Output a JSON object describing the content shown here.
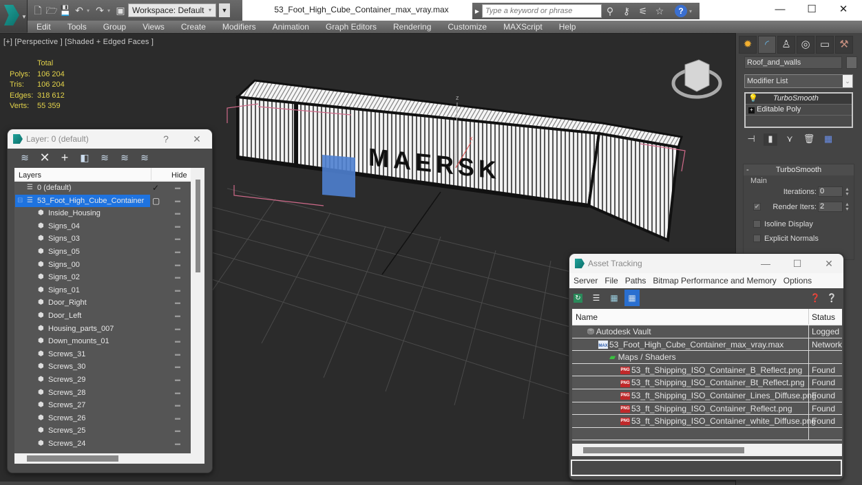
{
  "app": {
    "workspace_label": "Workspace: Default",
    "document_title": "53_Foot_High_Cube_Container_max_vray.max",
    "search_placeholder": "Type a keyword or phrase",
    "window_controls": {
      "minimize": "—",
      "maximize": "☐",
      "close": "✕"
    }
  },
  "menu": [
    "Edit",
    "Tools",
    "Group",
    "Views",
    "Create",
    "Modifiers",
    "Animation",
    "Graph Editors",
    "Rendering",
    "Customize",
    "MAXScript",
    "Help"
  ],
  "viewport": {
    "label": "[+] [Perspective ] [Shaded + Edged Faces ]",
    "stats": {
      "header": "Total",
      "rows": [
        {
          "label": "Polys:",
          "value": "106 204"
        },
        {
          "label": "Tris:",
          "value": "106 204"
        },
        {
          "label": "Edges:",
          "value": "318 612"
        },
        {
          "label": "Verts:",
          "value": "55 359"
        }
      ]
    },
    "axis_labels": {
      "z": "z",
      "x": "x"
    },
    "container_text": "MAERSK"
  },
  "command_panel": {
    "object_name": "Roof_and_walls",
    "modifier_list_label": "Modifier List",
    "stack": [
      {
        "label": "TurboSmooth",
        "selected": true
      },
      {
        "label": "Editable Poly",
        "selected": false
      }
    ],
    "rollout": {
      "title": "TurboSmooth",
      "group": "Main",
      "iterations_label": "Iterations:",
      "iterations_value": "0",
      "render_iters_label": "Render Iters:",
      "render_iters_value": "2",
      "render_iters_checked": true,
      "isoline_label": "Isoline Display",
      "explicit_normals_label": "Explicit Normals"
    }
  },
  "layer_window": {
    "title": "Layer: 0 (default)",
    "help": "?",
    "close": "✕",
    "col_layers": "Layers",
    "col_hide": "Hide",
    "layers": [
      {
        "name": "0 (default)",
        "level": 0,
        "type": "layer",
        "current": true
      },
      {
        "name": "53_Foot_High_Cube_Container",
        "level": 0,
        "type": "layer",
        "selected": true
      },
      {
        "name": "Inside_Housing",
        "level": 1,
        "type": "object"
      },
      {
        "name": "Signs_04",
        "level": 1,
        "type": "object"
      },
      {
        "name": "Signs_03",
        "level": 1,
        "type": "object"
      },
      {
        "name": "Signs_05",
        "level": 1,
        "type": "object"
      },
      {
        "name": "Signs_00",
        "level": 1,
        "type": "object"
      },
      {
        "name": "Signs_02",
        "level": 1,
        "type": "object"
      },
      {
        "name": "Signs_01",
        "level": 1,
        "type": "object"
      },
      {
        "name": "Door_Right",
        "level": 1,
        "type": "object"
      },
      {
        "name": "Door_Left",
        "level": 1,
        "type": "object"
      },
      {
        "name": "Housing_parts_007",
        "level": 1,
        "type": "object"
      },
      {
        "name": "Down_mounts_01",
        "level": 1,
        "type": "object"
      },
      {
        "name": "Screws_31",
        "level": 1,
        "type": "object"
      },
      {
        "name": "Screws_30",
        "level": 1,
        "type": "object"
      },
      {
        "name": "Screws_29",
        "level": 1,
        "type": "object"
      },
      {
        "name": "Screws_28",
        "level": 1,
        "type": "object"
      },
      {
        "name": "Screws_27",
        "level": 1,
        "type": "object"
      },
      {
        "name": "Screws_26",
        "level": 1,
        "type": "object"
      },
      {
        "name": "Screws_25",
        "level": 1,
        "type": "object"
      },
      {
        "name": "Screws_24",
        "level": 1,
        "type": "object"
      }
    ]
  },
  "asset_window": {
    "title": "Asset Tracking",
    "menu": [
      "Server",
      "File",
      "Paths",
      "Bitmap Performance and Memory",
      "Options"
    ],
    "col_name": "Name",
    "col_status": "Status",
    "rows": [
      {
        "name": "Autodesk Vault",
        "status": "Logged",
        "level": 0,
        "icon": "vault"
      },
      {
        "name": "53_Foot_High_Cube_Container_max_vray.max",
        "status": "Network",
        "level": 1,
        "icon": "max"
      },
      {
        "name": "Maps / Shaders",
        "status": "",
        "level": 2,
        "icon": "maps"
      },
      {
        "name": "53_ft_Shipping_ISO_Container_B_Reflect.png",
        "status": "Found",
        "level": 3,
        "icon": "png"
      },
      {
        "name": "53_ft_Shipping_ISO_Container_Bt_Reflect.png",
        "status": "Found",
        "level": 3,
        "icon": "png"
      },
      {
        "name": "53_ft_Shipping_ISO_Container_Lines_Diffuse.png",
        "status": "Found",
        "level": 3,
        "icon": "png"
      },
      {
        "name": "53_ft_Shipping_ISO_Container_Reflect.png",
        "status": "Found",
        "level": 3,
        "icon": "png"
      },
      {
        "name": "53_ft_Shipping_ISO_Container_white_Diffuse.png",
        "status": "Found",
        "level": 3,
        "icon": "png"
      }
    ]
  },
  "colors": {
    "stats_text": "#e2d24a",
    "selection_blue": "#1e73e0",
    "viewport_bg": "#2b2b2b",
    "bbox_pink": "#d06a8a",
    "teal_logo": "#1fa29a"
  }
}
